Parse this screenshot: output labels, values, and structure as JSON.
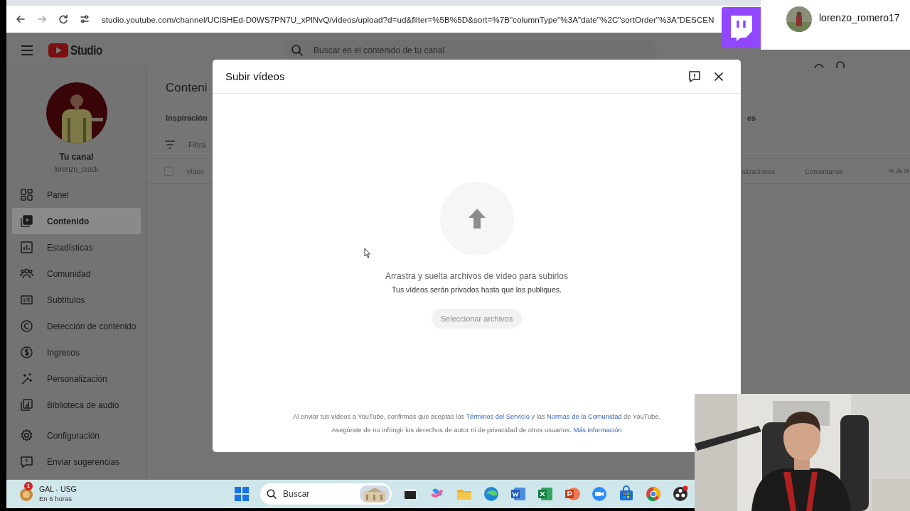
{
  "browser": {
    "url": "studio.youtube.com/channel/UClSHEd-D0WS7PN7U_xPlNvQ/videos/upload?d=ud&filter=%5B%5D&sort=%7B\"columnType\"%3A\"date\"%2C\"sortOrder\"%3A\"DESCEN"
  },
  "header": {
    "logo": "Studio",
    "search_placeholder": "Buscar en el contenido de tu canal"
  },
  "channel": {
    "title": "Tu canal",
    "handle": "lorenzo_crack"
  },
  "nav": [
    {
      "label": "Panel",
      "selected": false
    },
    {
      "label": "Contenido",
      "selected": true
    },
    {
      "label": "Estadísticas",
      "selected": false
    },
    {
      "label": "Comunidad",
      "selected": false
    },
    {
      "label": "Subtítulos",
      "selected": false
    },
    {
      "label": "Detección de contenido",
      "selected": false
    },
    {
      "label": "Ingresos",
      "selected": false
    },
    {
      "label": "Personalización",
      "selected": false
    },
    {
      "label": "Biblioteca de audio",
      "selected": false
    }
  ],
  "nav_footer": [
    {
      "label": "Configuración"
    },
    {
      "label": "Enviar sugerencias"
    }
  ],
  "content": {
    "title": "Conteni",
    "tabs": [
      "Inspiración",
      "es"
    ],
    "filter_placeholder": "Filtra",
    "select_all_checked": false,
    "columns": [
      "Vídeo",
      "alizaciones",
      "Comentarios",
      "% de M"
    ]
  },
  "dialog": {
    "title": "Subir vídeos",
    "drop_text": "Arrastra y suelta archivos de vídeo para subirlos",
    "private_note": "Tus vídeos serán privados hasta que los publiques.",
    "button": "Seleccionar archivos",
    "legal": [
      [
        {
          "kind": "text",
          "text": "Al enviar tus vídeos a YouTube, confirmas que aceptas los "
        },
        {
          "kind": "link",
          "text": "Términos del Servicio"
        },
        {
          "kind": "text",
          "text": " y las "
        },
        {
          "kind": "link",
          "text": "Normas de la Comunidad"
        },
        {
          "kind": "text",
          "text": " de YouTube."
        }
      ],
      [
        {
          "kind": "text",
          "text": "Asegúrate de no infringir los derechos de autor ni de privacidad de otros usuarios. "
        },
        {
          "kind": "link",
          "text": "Más información"
        }
      ]
    ]
  },
  "taskbar": {
    "weather": {
      "badge": "1",
      "title": "GAL - USG",
      "subtitle": "En 6 horas"
    },
    "search_placeholder": "Buscar"
  },
  "stream_overlay": {
    "username": "lorenzo_romero17"
  }
}
